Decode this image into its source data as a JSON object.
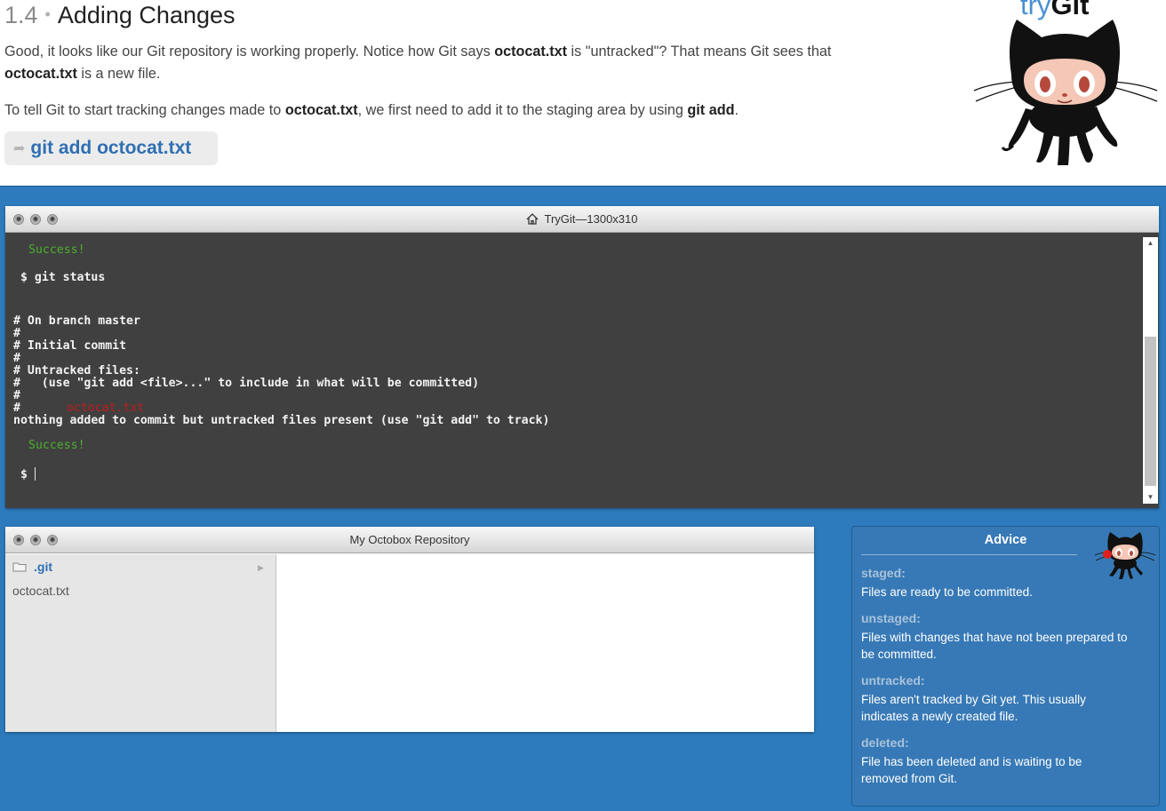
{
  "lesson": {
    "number": "1.4",
    "separator": "•",
    "title": "Adding Changes",
    "p1_a": "Good, it looks like our Git repository is working properly. Notice how Git says ",
    "p1_b": "octocat.txt",
    "p1_c": " is \"untracked\"? That means Git sees that",
    "p1_d": "octocat.txt",
    "p1_e": " is a new file.",
    "p2_a": "To tell Git to start tracking changes made to ",
    "p2_b": "octocat.txt",
    "p2_c": ", we first need to add it to the staging area by using ",
    "p2_d": "git add",
    "p2_e": ".",
    "command": "git add octocat.txt"
  },
  "brand": {
    "try": "try",
    "git": "Git"
  },
  "terminal": {
    "title": "TryGit—1300x310",
    "success1": "Success!",
    "prompt1": "$ git status",
    "l1": "# On branch master",
    "l2": "#",
    "l3": "# Initial commit",
    "l4": "#",
    "l5": "# Untracked files:",
    "l6": "#   (use \"git add <file>...\" to include in what will be committed)",
    "l7": "#",
    "l8_hash": "#",
    "l8_file": "octocat.txt",
    "l9": "nothing added to commit but untracked files present (use \"git add\" to track)",
    "success2": "Success!",
    "prompt2": "$ "
  },
  "repo": {
    "title": "My Octobox Repository",
    "folder": ".git",
    "file": "octocat.txt"
  },
  "advice": {
    "title": "Advice",
    "items": [
      {
        "term": "staged:",
        "def": "Files are ready to be committed."
      },
      {
        "term": "unstaged:",
        "def": "Files with changes that have not been prepared to be committed."
      },
      {
        "term": "untracked:",
        "def": "Files aren't tracked by Git yet. This usually indicates a newly created file."
      },
      {
        "term": "deleted:",
        "def": "File has been deleted and is waiting to be removed from Git."
      }
    ]
  },
  "colors": {
    "page_bg": "#2d7bbd",
    "terminal_bg": "#404040",
    "success_green": "#4caf2d",
    "untracked_red": "#c21b1b",
    "link_blue": "#2f6fb3"
  },
  "icons": [
    "arrow-right-icon",
    "house-icon",
    "folder-icon",
    "chevron-right-icon",
    "octocat-logo"
  ]
}
